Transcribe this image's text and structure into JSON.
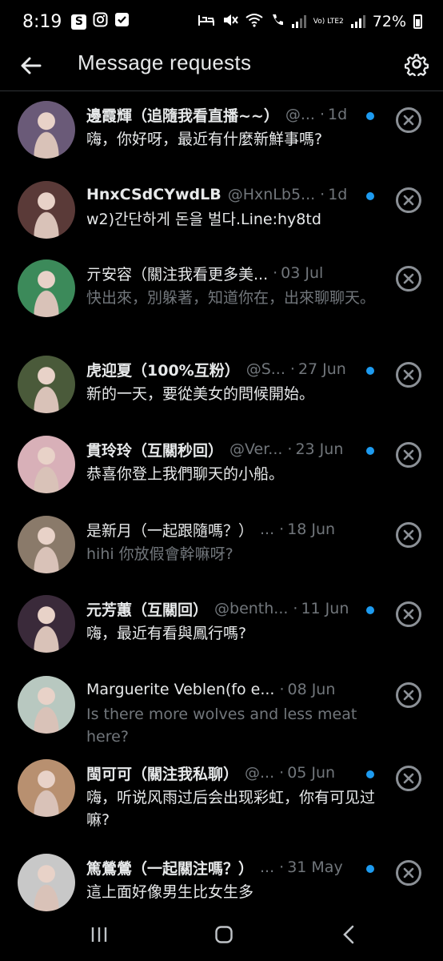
{
  "status_bar": {
    "time": "8:19",
    "app_icons": [
      "S",
      "instagram-icon",
      "check-square-icon"
    ],
    "network": "Vo) LTE2",
    "battery": "72%",
    "battery_level": 0.72
  },
  "header": {
    "title": "Message requests",
    "back_icon": "arrow-left-icon",
    "settings_icon": "gear-icon"
  },
  "requests": [
    {
      "name": "邊霞輝（追隨我看直播~~）",
      "handle": "@...",
      "date": "1d",
      "message": "嗨，你好呀，最近有什麼新鮮事嗎?",
      "unread": true,
      "avatar_color": "#6a5a78"
    },
    {
      "name": "HnxCSdCYwdLB",
      "handle": "@HxnLb5...",
      "date": "1d",
      "message": "w2)간단하게 돈을 벌다.Line:hy8td",
      "unread": true,
      "avatar_color": "#5a3a38"
    },
    {
      "name": "亓安容（關注我看更多美...",
      "handle": "",
      "date": "03 Jul",
      "message": "快出來，別躲著，知道你在，出來聊聊天。",
      "unread": false,
      "avatar_color": "#3c8a5a"
    },
    {
      "name": "虎迎夏（100%互粉）",
      "handle": "@S...",
      "date": "27 Jun",
      "message": "新的一天，要從美女的問候開始。",
      "unread": true,
      "avatar_color": "#4a5a3a"
    },
    {
      "name": "貫玲玲（互關秒回）",
      "handle": "@Ver...",
      "date": "23 Jun",
      "message": "恭喜你登上我們聊天的小船。",
      "unread": true,
      "avatar_color": "#d8b0b8"
    },
    {
      "name": "是新月（一起跟隨嗎？）",
      "handle": "...",
      "date": "18 Jun",
      "message": "hihi 你放假會幹嘛呀?",
      "unread": false,
      "avatar_color": "#8a7a6a"
    },
    {
      "name": "元芳蕙（互關回）",
      "handle": "@benth...",
      "date": "11 Jun",
      "message": "嗨，最近有看與鳳行嗎?",
      "unread": true,
      "avatar_color": "#3a2a3a"
    },
    {
      "name": "Marguerite Veblen(fo e...",
      "handle": "",
      "date": "08 Jun",
      "message": "Is there more wolves and less meat here?",
      "unread": false,
      "avatar_color": "#b8c8c0"
    },
    {
      "name": "閩可可（關注我私聊）",
      "handle": "@...",
      "date": "05 Jun",
      "message": "嗨，听说风雨过后会出现彩虹，你有可见过嘛?",
      "unread": true,
      "avatar_color": "#b89070"
    },
    {
      "name": "篤鶯鶯（一起關注嗎？）",
      "handle": "...",
      "date": "31 May",
      "message": "這上面好像男生比女生多",
      "unread": true,
      "avatar_color": "#c8c8c8"
    }
  ],
  "date_separator": "·",
  "dismiss_icon": "close-circle-icon",
  "nav_bar": [
    "recent-apps-icon",
    "home-icon",
    "back-icon"
  ]
}
